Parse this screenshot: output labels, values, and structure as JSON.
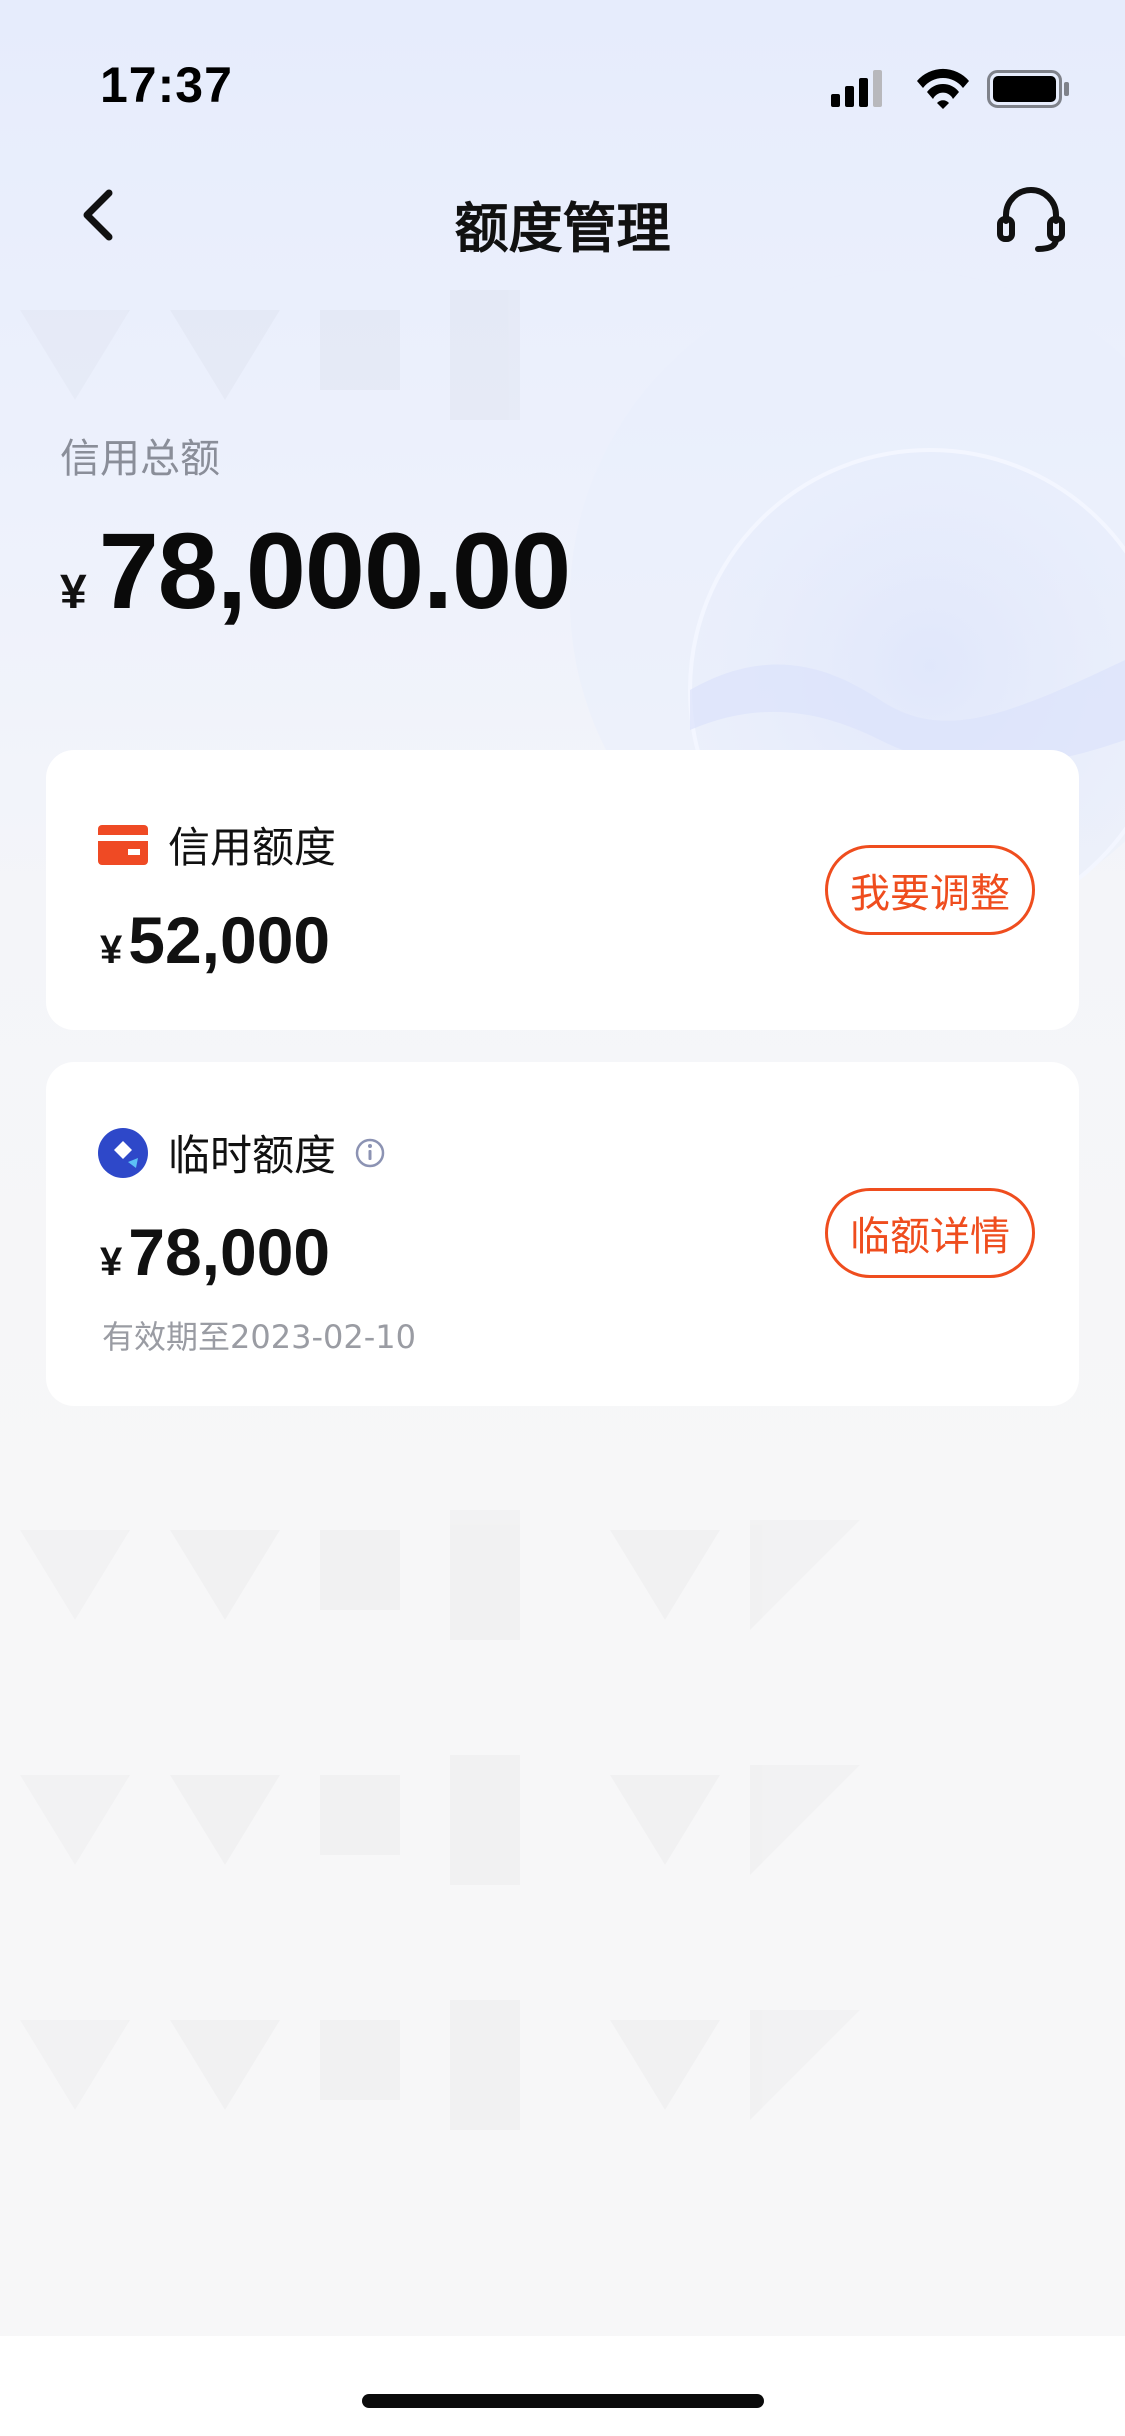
{
  "status_bar": {
    "time": "17:37"
  },
  "nav": {
    "title": "额度管理",
    "back_icon": "chevron-left-icon",
    "support_icon": "headset-icon"
  },
  "summary": {
    "label": "信用总额",
    "currency": "¥",
    "amount": "78,000.00"
  },
  "cards": [
    {
      "title": "信用额度",
      "icon": "card-icon",
      "currency": "¥",
      "amount": "52,000",
      "button": "我要调整"
    },
    {
      "title": "临时额度",
      "icon": "temp-credit-icon",
      "info_icon": "info-icon",
      "currency": "¥",
      "amount": "78,000",
      "validity": "有效期至2023-02-10",
      "button": "临额详情"
    }
  ],
  "colors": {
    "accent": "#ef4d1e",
    "brand_blue": "#2e48c9",
    "muted_text": "#9a9ca3"
  }
}
